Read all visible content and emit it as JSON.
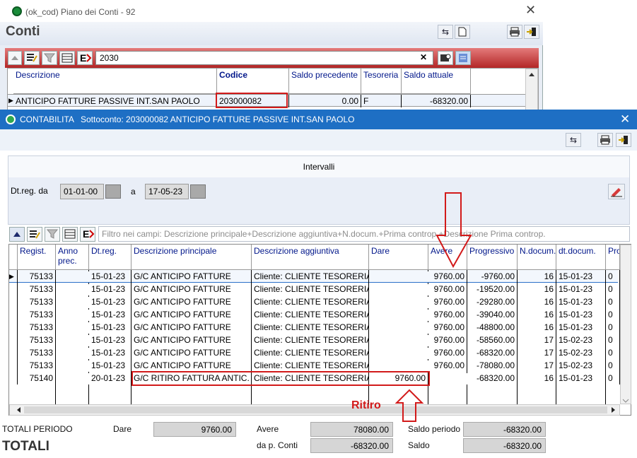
{
  "back_window": {
    "title": "(ok_cod) Piano dei Conti - 92",
    "heading": "Conti",
    "search_value": "2030",
    "clear_glyph": "✕",
    "columns": [
      "Descrizione",
      "Codice",
      "Saldo precedente",
      "Tesoreria",
      "Saldo attuale"
    ],
    "row": {
      "descrizione": "ANTICIPO FATTURE PASSIVE INT.SAN PAOLO",
      "codice": "203000082",
      "saldo_precedente": "0.00",
      "tesoreria": "F",
      "saldo_attuale": "-68320.00"
    }
  },
  "front_window": {
    "app": "CONTABILITA",
    "title": "Sottoconto: 203000082 ANTICIPO FATTURE PASSIVE INT.SAN PAOLO",
    "intervals_label": "Intervalli",
    "date_from_label": "Dt.reg. da",
    "date_from": "01-01-00",
    "date_to_label": "a",
    "date_to": "17-05-23",
    "filter_placeholder": "Filtro nei campi: Descrizione principale+Descrizione aggiuntiva+N.docum.+Prima controp.+Descrizione Prima controp.",
    "columns": [
      "Regist.",
      "Anno prec.",
      "Dt.reg.",
      "Descrizione principale",
      "Descrizione aggiuntiva",
      "Dare",
      "Avere",
      "Progressivo",
      "N.docum.",
      "dt.docum.",
      "Pro"
    ],
    "rows": [
      {
        "regist": "75133",
        "dtreg": "15-01-23",
        "desc": "G/C ANTICIPO FATTURE",
        "agg": "Cliente: CLIENTE TESORERIA",
        "dare": "",
        "avere": "9760.00",
        "prog": "-9760.00",
        "ndoc": "16",
        "dtdoc": "15-01-23",
        "pro": "0"
      },
      {
        "regist": "75133",
        "dtreg": "15-01-23",
        "desc": "G/C ANTICIPO FATTURE",
        "agg": "Cliente: CLIENTE TESORERIA",
        "dare": "",
        "avere": "9760.00",
        "prog": "-19520.00",
        "ndoc": "16",
        "dtdoc": "15-01-23",
        "pro": "0"
      },
      {
        "regist": "75133",
        "dtreg": "15-01-23",
        "desc": "G/C ANTICIPO FATTURE",
        "agg": "Cliente: CLIENTE TESORERIA",
        "dare": "",
        "avere": "9760.00",
        "prog": "-29280.00",
        "ndoc": "16",
        "dtdoc": "15-01-23",
        "pro": "0"
      },
      {
        "regist": "75133",
        "dtreg": "15-01-23",
        "desc": "G/C ANTICIPO FATTURE",
        "agg": "Cliente: CLIENTE TESORERIA",
        "dare": "",
        "avere": "9760.00",
        "prog": "-39040.00",
        "ndoc": "16",
        "dtdoc": "15-01-23",
        "pro": "0"
      },
      {
        "regist": "75133",
        "dtreg": "15-01-23",
        "desc": "G/C ANTICIPO FATTURE",
        "agg": "Cliente: CLIENTE TESORERIA",
        "dare": "",
        "avere": "9760.00",
        "prog": "-48800.00",
        "ndoc": "16",
        "dtdoc": "15-01-23",
        "pro": "0"
      },
      {
        "regist": "75133",
        "dtreg": "15-01-23",
        "desc": "G/C ANTICIPO FATTURE",
        "agg": "Cliente: CLIENTE TESORERIA",
        "dare": "",
        "avere": "9760.00",
        "prog": "-58560.00",
        "ndoc": "17",
        "dtdoc": "15-02-23",
        "pro": "0"
      },
      {
        "regist": "75133",
        "dtreg": "15-01-23",
        "desc": "G/C ANTICIPO FATTURE",
        "agg": "Cliente: CLIENTE TESORERIA",
        "dare": "",
        "avere": "9760.00",
        "prog": "-68320.00",
        "ndoc": "17",
        "dtdoc": "15-02-23",
        "pro": "0"
      },
      {
        "regist": "75133",
        "dtreg": "15-01-23",
        "desc": "G/C ANTICIPO FATTURE",
        "agg": "Cliente: CLIENTE TESORERIA",
        "dare": "",
        "avere": "9760.00",
        "prog": "-78080.00",
        "ndoc": "17",
        "dtdoc": "15-02-23",
        "pro": "0"
      },
      {
        "regist": "75140",
        "dtreg": "20-01-23",
        "desc": "G/C RITIRO FATTURA ANTIC.",
        "agg": "Cliente: CLIENTE TESORERIA",
        "dare": "9760.00",
        "avere": "",
        "prog": "-68320.00",
        "ndoc": "16",
        "dtdoc": "15-01-23",
        "pro": "0"
      }
    ],
    "annotation": "Ritiro",
    "totals": {
      "periodo_label": "TOTALI PERIODO",
      "totali_label": "TOTALI",
      "dare_label": "Dare",
      "dare_value": "9760.00",
      "avere_label": "Avere",
      "avere_value": "78080.00",
      "dapconti_label": "da p. Conti",
      "dapconti_value": "-68320.00",
      "saldo_periodo_label": "Saldo periodo",
      "saldo_periodo_value": "-68320.00",
      "saldo_label": "Saldo",
      "saldo_value": "-68320.00"
    }
  },
  "colors": {
    "accent_blue": "#1e6fc4",
    "header_text": "#00168a",
    "annotation_red": "#d21a1a"
  }
}
